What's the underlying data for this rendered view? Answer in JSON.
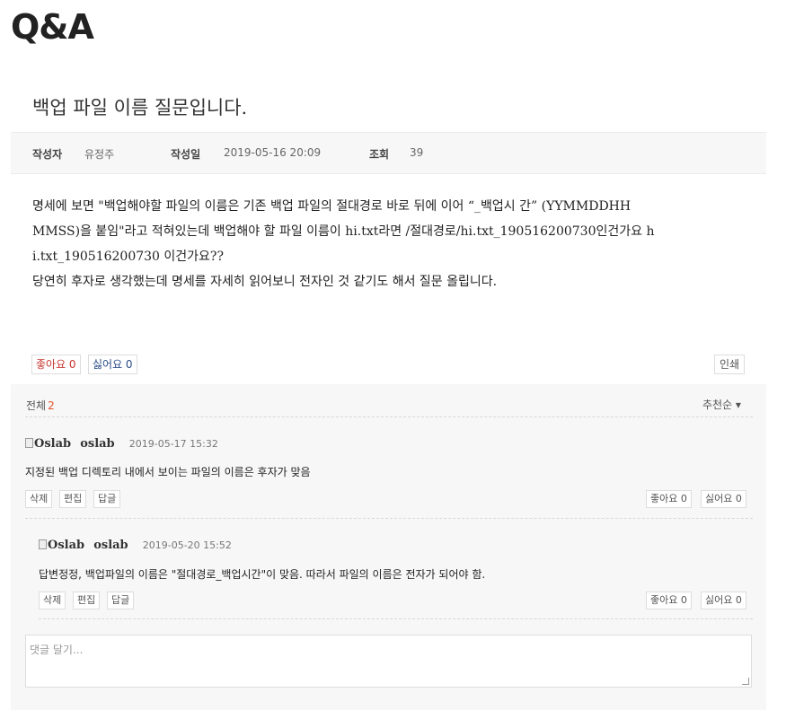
{
  "page": {
    "title": "Q&A"
  },
  "post": {
    "title": "백업 파일 이름 질문입니다.",
    "author_label": "작성자",
    "author": "유정주",
    "date_label": "작성일",
    "date": "2019-05-16 20:09",
    "views_label": "조회",
    "views": "39",
    "body": [
      "명세에 보면 \"백업해야할 파일의 이름은 기존 백업 파일의 절대경로 바로 뒤에 이어 “_백업시 간” (YYMMDDHH",
      "MMSS)을 붙임\"라고 적혀있는데 백업해야 할 파일 이름이 hi.txt라면 /절대경로/hi.txt_190516200730인건가요 h",
      "i.txt_190516200730 이건가요??",
      "당연히 후자로 생각했는데 명세를 자세히 읽어보니 전자인 것 같기도 해서 질문 올립니다."
    ],
    "like_label": "좋아요 0",
    "dislike_label": "싫어요 0",
    "print_label": "인쇄"
  },
  "comments_section": {
    "total_label": "전체",
    "total_count": "2",
    "sort_label": "추천순 ▾",
    "comments": [
      {
        "avatar_alt": "Oslab",
        "author": "oslab",
        "date": "2019-05-17 15:32",
        "text": "지정된 백업 디렉토리 내에서 보이는 파일의 이름은 후자가 맞음",
        "delete_label": "삭제",
        "edit_label": "편집",
        "reply_label": "답글",
        "like_label": "좋아요 0",
        "dislike_label": "싫어요 0"
      },
      {
        "avatar_alt": "Oslab",
        "author": "oslab",
        "date": "2019-05-20 15:52",
        "text": "답변정정, 백업파일의 이름은 \"절대경로_백업시간\"이 맞음. 따라서 파일의 이름은 전자가 되어야 함.",
        "delete_label": "삭제",
        "edit_label": "편집",
        "reply_label": "답글",
        "like_label": "좋아요 0",
        "dislike_label": "싫어요 0"
      }
    ],
    "reply_placeholder": "댓글 달기..."
  }
}
